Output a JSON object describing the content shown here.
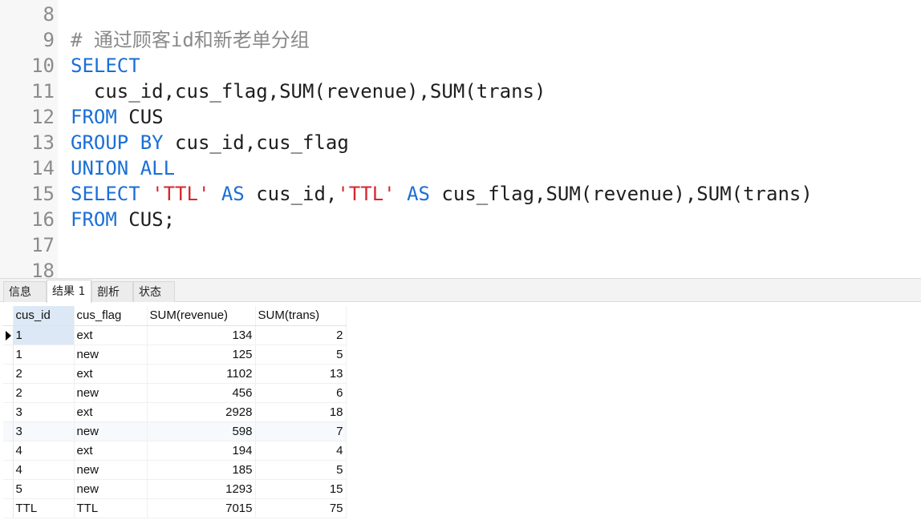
{
  "editor": {
    "lines": [
      {
        "n": "8",
        "parts": []
      },
      {
        "n": "9",
        "parts": [
          {
            "t": "# 通过顾客id和新老单分组",
            "c": "cmt"
          }
        ]
      },
      {
        "n": "10",
        "parts": [
          {
            "t": "SELECT",
            "c": "kw"
          }
        ]
      },
      {
        "n": "11",
        "parts": [
          {
            "t": "  cus_id,cus_flag,SUM(revenue),SUM(trans)",
            "c": ""
          }
        ]
      },
      {
        "n": "12",
        "parts": [
          {
            "t": "FROM",
            "c": "kw"
          },
          {
            "t": " CUS",
            "c": ""
          }
        ]
      },
      {
        "n": "13",
        "parts": [
          {
            "t": "GROUP BY",
            "c": "kw"
          },
          {
            "t": " cus_id,cus_flag",
            "c": ""
          }
        ]
      },
      {
        "n": "14",
        "parts": [
          {
            "t": "UNION ALL",
            "c": "kw"
          }
        ]
      },
      {
        "n": "15",
        "parts": [
          {
            "t": "SELECT",
            "c": "kw"
          },
          {
            "t": " ",
            "c": ""
          },
          {
            "t": "'TTL'",
            "c": "str"
          },
          {
            "t": " ",
            "c": ""
          },
          {
            "t": "AS",
            "c": "kw"
          },
          {
            "t": " cus_id,",
            "c": ""
          },
          {
            "t": "'TTL'",
            "c": "str"
          },
          {
            "t": " ",
            "c": ""
          },
          {
            "t": "AS",
            "c": "kw"
          },
          {
            "t": " cus_flag,SUM(revenue),SUM(trans)",
            "c": ""
          }
        ]
      },
      {
        "n": "16",
        "parts": [
          {
            "t": "FROM",
            "c": "kw"
          },
          {
            "t": " CUS;",
            "c": ""
          }
        ]
      },
      {
        "n": "17",
        "parts": []
      },
      {
        "n": "18",
        "parts": []
      }
    ]
  },
  "tabs": [
    {
      "label": "信息",
      "active": false
    },
    {
      "label": "结果 1",
      "active": true
    },
    {
      "label": "剖析",
      "active": false
    },
    {
      "label": "状态",
      "active": false
    }
  ],
  "grid": {
    "columns": [
      "cus_id",
      "cus_flag",
      "SUM(revenue)",
      "SUM(trans)"
    ],
    "rows": [
      [
        "1",
        "ext",
        "134",
        "2"
      ],
      [
        "1",
        "new",
        "125",
        "5"
      ],
      [
        "2",
        "ext",
        "1102",
        "13"
      ],
      [
        "2",
        "new",
        "456",
        "6"
      ],
      [
        "3",
        "ext",
        "2928",
        "18"
      ],
      [
        "3",
        "new",
        "598",
        "7"
      ],
      [
        "4",
        "ext",
        "194",
        "4"
      ],
      [
        "4",
        "new",
        "185",
        "5"
      ],
      [
        "5",
        "new",
        "1293",
        "15"
      ],
      [
        "TTL",
        "TTL",
        "7015",
        "75"
      ]
    ],
    "selected_row": 0
  }
}
